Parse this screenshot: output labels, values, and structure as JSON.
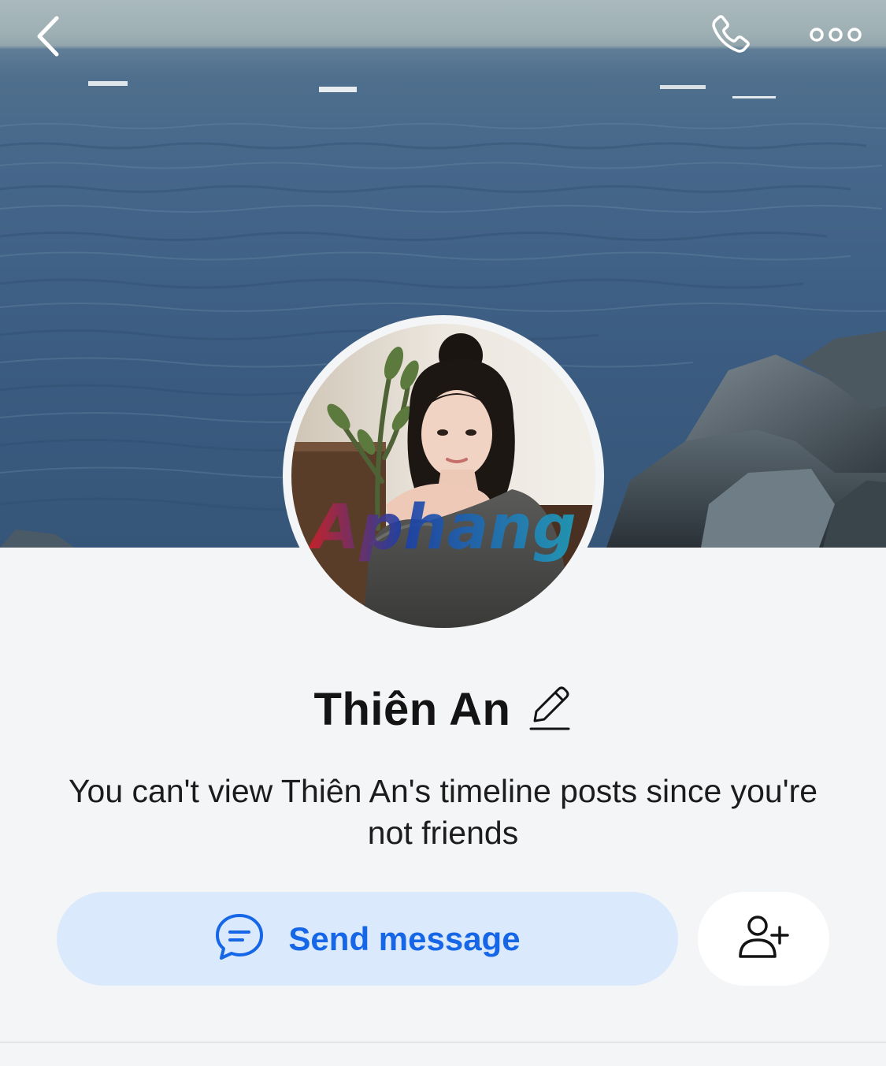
{
  "profile": {
    "name": "Thiên An",
    "notice": "You can't view Thiên An's timeline posts since you're not friends",
    "avatar_watermark": "Aphang"
  },
  "actions": {
    "send_message_label": "Send message"
  },
  "icons": {
    "back": "chevron-left-icon",
    "call": "phone-icon",
    "more": "more-dots-icon",
    "edit": "pencil-icon",
    "message": "chat-bubble-icon",
    "add_friend": "add-friend-icon"
  },
  "colors": {
    "background": "#f4f5f7",
    "accent": "#1666e8",
    "send_button_bg": "#dbe9fc",
    "text": "#141414"
  }
}
